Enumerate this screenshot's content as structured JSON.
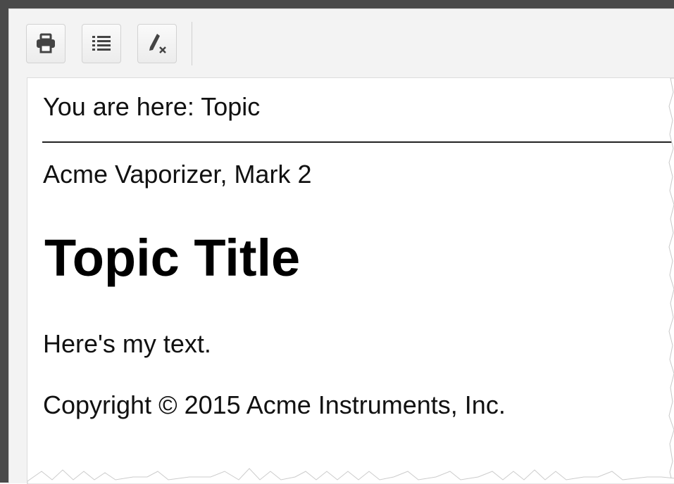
{
  "toolbar": {
    "buttons": [
      {
        "icon": "printer-icon"
      },
      {
        "icon": "list-icon"
      },
      {
        "icon": "clear-format-icon"
      }
    ]
  },
  "topic": {
    "breadcrumb": "You are here: Topic",
    "product": "Acme Vaporizer, Mark 2",
    "title": "Topic Title",
    "body": "Here's my text.",
    "copyright": "Copyright © 2015 Acme Instruments, Inc."
  }
}
